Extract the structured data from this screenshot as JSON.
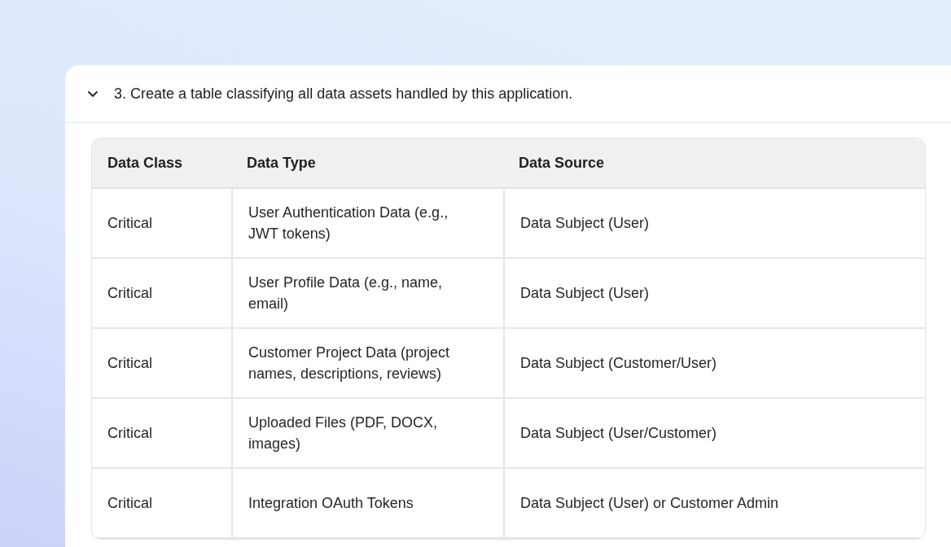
{
  "question": {
    "expanded": true,
    "text": "3. Create a table classifying all data assets handled by this application."
  },
  "table": {
    "columns": [
      "Data Class",
      "Data Type",
      "Data Source"
    ],
    "rows": [
      [
        "Critical",
        "User Authentication Data (e.g., JWT tokens)",
        "Data Subject (User)"
      ],
      [
        "Critical",
        "User Profile Data (e.g., name, email)",
        "Data Subject (User)"
      ],
      [
        "Critical",
        "Customer Project Data (project names, descriptions, reviews)",
        "Data Subject (Customer/User)"
      ],
      [
        "Critical",
        "Uploaded Files (PDF, DOCX, images)",
        "Data Subject (User/Customer)"
      ],
      [
        "Critical",
        "Integration OAuth Tokens",
        "Data Subject (User) or Customer Admin"
      ]
    ]
  }
}
